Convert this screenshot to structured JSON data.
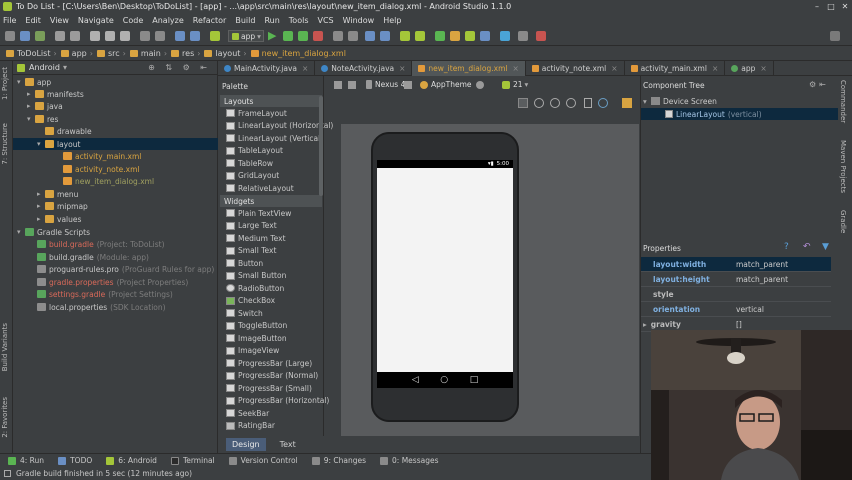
{
  "window": {
    "title": "To Do List - [C:\\Users\\Ben\\Desktop\\ToDoList] - [app] - ...\\app\\src\\main\\res\\layout\\new_item_dialog.xml - Android Studio 1.1.0",
    "controls": [
      "–",
      "□",
      "✕"
    ]
  },
  "menu": [
    "File",
    "Edit",
    "View",
    "Navigate",
    "Code",
    "Analyze",
    "Refactor",
    "Build",
    "Run",
    "Tools",
    "VCS",
    "Window",
    "Help"
  ],
  "toolbar": {
    "run_config": "app"
  },
  "breadcrumbs": [
    "ToDoList",
    "app",
    "src",
    "main",
    "res",
    "layout",
    "new_item_dialog.xml"
  ],
  "project": {
    "view_selector": "Android",
    "tree": [
      {
        "label": "app",
        "extra": ""
      },
      {
        "label": "manifests",
        "extra": ""
      },
      {
        "label": "java",
        "extra": ""
      },
      {
        "label": "res",
        "extra": ""
      },
      {
        "label": "drawable",
        "extra": ""
      },
      {
        "label": "layout",
        "extra": ""
      },
      {
        "label": "activity_main.xml",
        "extra": ""
      },
      {
        "label": "activity_note.xml",
        "extra": ""
      },
      {
        "label": "new_item_dialog.xml",
        "extra": ""
      },
      {
        "label": "menu",
        "extra": ""
      },
      {
        "label": "mipmap",
        "extra": ""
      },
      {
        "label": "values",
        "extra": ""
      },
      {
        "label": "Gradle Scripts",
        "extra": ""
      },
      {
        "label": "build.gradle",
        "extra": "(Project: ToDoList)"
      },
      {
        "label": "build.gradle",
        "extra": "(Module: app)"
      },
      {
        "label": "proguard-rules.pro",
        "extra": "(ProGuard Rules for app)"
      },
      {
        "label": "gradle.properties",
        "extra": "(Project Properties)"
      },
      {
        "label": "settings.gradle",
        "extra": "(Project Settings)"
      },
      {
        "label": "local.properties",
        "extra": "(SDK Location)"
      }
    ]
  },
  "side_tabs": {
    "left": [
      "1: Project",
      "7: Structure",
      "Build Variants",
      "2: Favorites"
    ],
    "right": [
      "Commander",
      "Maven Projects",
      "Gradle"
    ]
  },
  "editor_tabs": [
    {
      "label": "MainActivity.java"
    },
    {
      "label": "NoteActivity.java"
    },
    {
      "label": "new_item_dialog.xml"
    },
    {
      "label": "activity_note.xml"
    },
    {
      "label": "activity_main.xml"
    },
    {
      "label": "app"
    }
  ],
  "palette": {
    "title": "Palette",
    "groups": [
      {
        "name": "Layouts",
        "items": [
          "FrameLayout",
          "LinearLayout (Horizontal)",
          "LinearLayout (Vertical)",
          "TableLayout",
          "TableRow",
          "GridLayout",
          "RelativeLayout"
        ]
      },
      {
        "name": "Widgets",
        "items": [
          "Plain TextView",
          "Large Text",
          "Medium Text",
          "Small Text",
          "Button",
          "Small Button",
          "RadioButton",
          "CheckBox",
          "Switch",
          "ToggleButton",
          "ImageButton",
          "ImageView",
          "ProgressBar (Large)",
          "ProgressBar (Normal)",
          "ProgressBar (Small)",
          "ProgressBar (Horizontal)",
          "SeekBar",
          "RatingBar"
        ]
      }
    ]
  },
  "design_toolbar": {
    "device": "Nexus 4",
    "theme": "AppTheme",
    "api": "21"
  },
  "device_preview": {
    "clock": "5:00"
  },
  "editor_mode_tabs": [
    "Design",
    "Text"
  ],
  "component_tree": {
    "title": "Component Tree",
    "root": "Device Screen",
    "child": "LinearLayout",
    "child_extra": "(vertical)"
  },
  "properties": {
    "title": "Properties",
    "rows": [
      {
        "key": "layout:width",
        "value": "match_parent"
      },
      {
        "key": "layout:height",
        "value": "match_parent"
      },
      {
        "key": "style",
        "value": ""
      },
      {
        "key": "orientation",
        "value": "vertical"
      },
      {
        "key": "gravity",
        "value": "[]"
      }
    ]
  },
  "tool_windows": [
    "4: Run",
    "TODO",
    "6: Android",
    "Terminal",
    "Version Control",
    "9: Changes",
    "0: Messages"
  ],
  "status": "Gradle build finished in 5 sec (12 minutes ago)",
  "colors": {
    "accent": "#d9a441",
    "selection": "#0d293e",
    "android_green": "#a4c639"
  }
}
